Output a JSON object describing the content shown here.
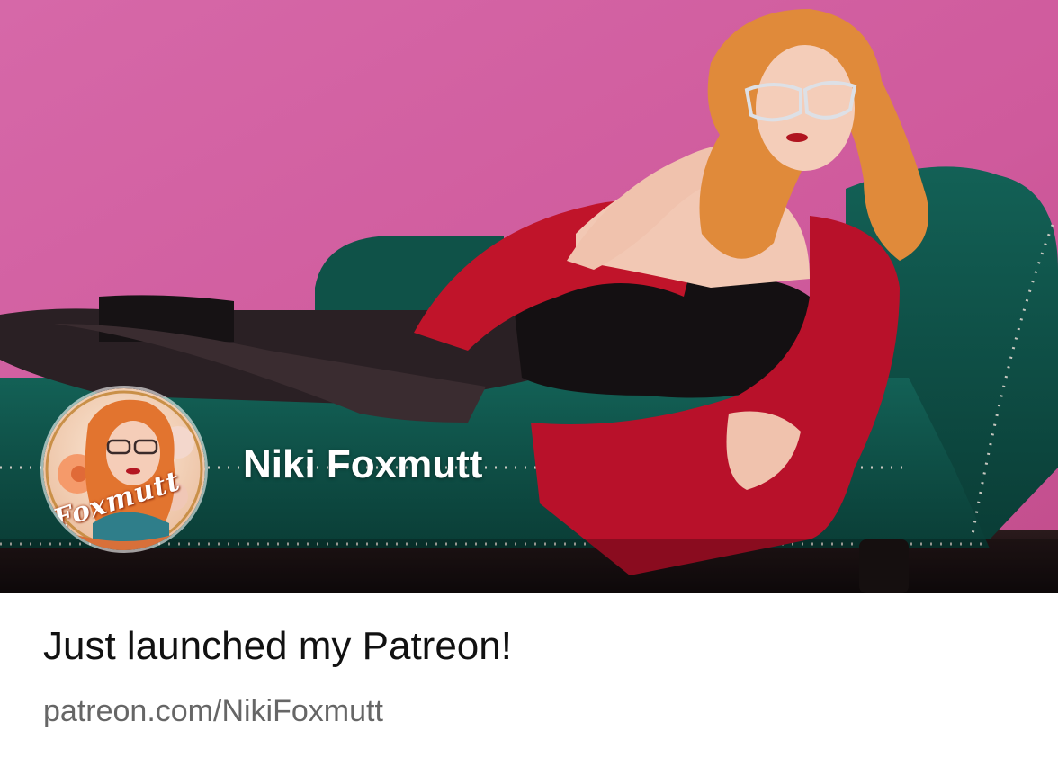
{
  "card": {
    "creator_name": "Niki Foxmutt",
    "headline": "Just launched my Patreon!",
    "url": "patreon.com/NikiFoxmutt",
    "avatar_text": "Foxmutt"
  },
  "colors": {
    "wall": "#d2609f",
    "couch": "#0f5248",
    "shawl": "#c0142a",
    "hair": "#e08a3a"
  }
}
